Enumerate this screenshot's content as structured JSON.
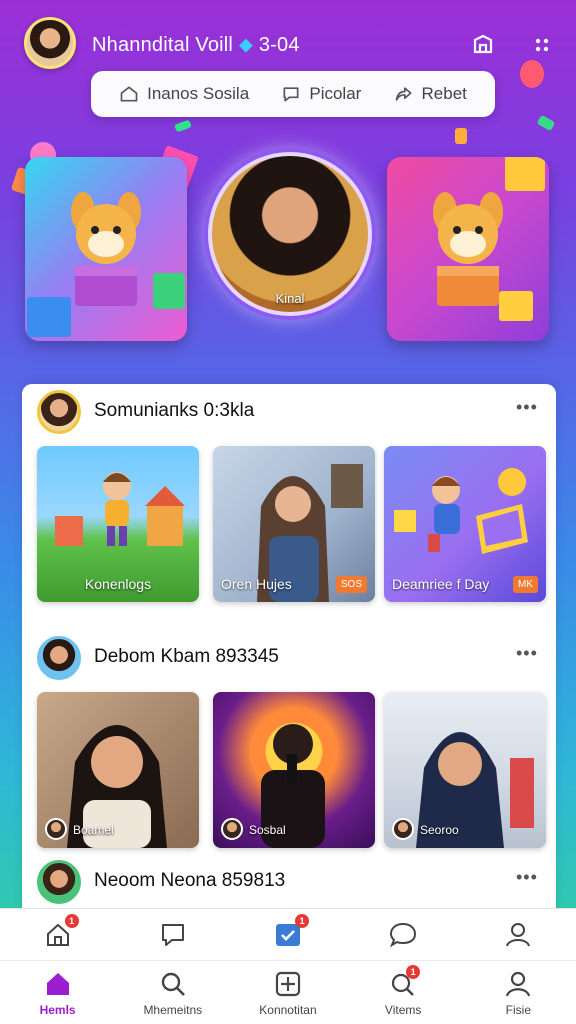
{
  "header": {
    "title": "Nhanndital Voill",
    "title_suffix": "3-04",
    "search": [
      {
        "label": "Inanos Sosila",
        "icon": "home-outline-icon"
      },
      {
        "label": "Picolar",
        "icon": "chat-bubble-icon"
      },
      {
        "label": "Rebet",
        "icon": "share-arrow-icon"
      }
    ]
  },
  "hero": {
    "center_caption": "Kinal"
  },
  "posts": [
    {
      "name": "Somuniaпks 0:3kla",
      "media": [
        {
          "label": "Konenlogs",
          "badge": ""
        },
        {
          "label": "Oren Hujes",
          "badge": "SOS"
        },
        {
          "label": "Deamriee f Day",
          "badge": "MK"
        }
      ]
    },
    {
      "name": "Debom Kbam 893345",
      "media": [
        {
          "label": "Boamel"
        },
        {
          "label": "Sosbal"
        },
        {
          "label": "Seoroo"
        }
      ]
    },
    {
      "name": "Neoom Neona 859813",
      "media": []
    }
  ],
  "top_bar": {
    "badges": [
      "1",
      "1",
      "1"
    ]
  },
  "bottom_nav": [
    {
      "label": "Hemls",
      "icon": "home-icon",
      "active": true
    },
    {
      "label": "Mhemeitns",
      "icon": "search-icon",
      "active": false
    },
    {
      "label": "Konnotitan",
      "icon": "add-square-icon",
      "active": false
    },
    {
      "label": "Vitems",
      "icon": "notifications-icon",
      "active": false
    },
    {
      "label": "Fisie",
      "icon": "profile-icon",
      "active": false
    }
  ],
  "colors": {
    "accent": "#9b1fd0",
    "badge": "#e53935"
  }
}
